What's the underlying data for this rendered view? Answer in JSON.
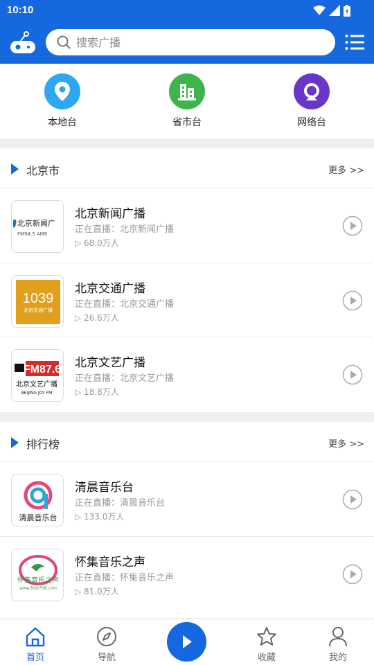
{
  "status_bar": {
    "time": "10:10"
  },
  "search": {
    "placeholder": "搜索广播"
  },
  "categories": [
    {
      "label": "本地台",
      "icon": "location-pin-icon",
      "color": "#2ea7f1"
    },
    {
      "label": "省市台",
      "icon": "building-icon",
      "color": "#3db54a"
    },
    {
      "label": "网络台",
      "icon": "network-icon",
      "color": "#6a36c9"
    }
  ],
  "sections": [
    {
      "title": "北京市",
      "more": "更多 >>",
      "items": [
        {
          "name": "北京新闻广播",
          "live": "正在直播：北京新闻广播",
          "listeners": "68.0万人",
          "logo_top": "北京新闻广",
          "logo_bottom": "FM94.5  AM8"
        },
        {
          "name": "北京交通广播",
          "live": "正在直播：北京交通广播",
          "listeners": "26.6万人",
          "logo_top": "1039",
          "logo_bottom": "北京交通广播"
        },
        {
          "name": "北京文艺广播",
          "live": "正在直播：北京文艺广播",
          "listeners": "18.8万人",
          "logo_top": "FM87.6",
          "logo_mid": "北京文艺广播",
          "logo_bottom": "BEIJING JOY FM"
        }
      ]
    },
    {
      "title": "排行榜",
      "more": "更多 >>",
      "items": [
        {
          "name": "清晨音乐台",
          "live": "正在直播：清晨音乐台",
          "listeners": "133.0万人",
          "logo_top": "清晨音乐台"
        },
        {
          "name": "怀集音乐之声",
          "live": "正在直播：怀集音乐之声",
          "listeners": "81.0万人",
          "logo_top": "怀集音乐之声",
          "logo_bottom": "www.fm0758.com"
        }
      ]
    }
  ],
  "tabs": [
    {
      "label": "首页",
      "icon": "home-icon",
      "active": true
    },
    {
      "label": "导航",
      "icon": "compass-icon",
      "active": false
    },
    {
      "label": "收藏",
      "icon": "star-icon",
      "active": false
    },
    {
      "label": "我的",
      "icon": "user-icon",
      "active": false
    }
  ],
  "colors": {
    "primary": "#1668df",
    "muted": "#999999"
  }
}
